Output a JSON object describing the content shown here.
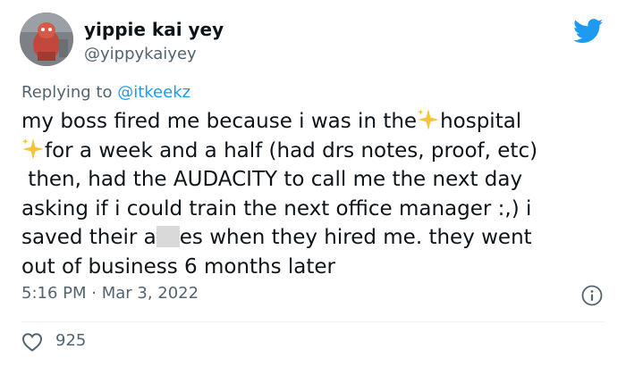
{
  "author": {
    "display_name": "yippie kai yey",
    "handle": "@yippykaiyey",
    "avatar_icon": "avatar-photo"
  },
  "reply": {
    "prefix": "Replying to ",
    "mention": "@itkeekz"
  },
  "tweet": {
    "line1_a": "my boss fired me because i was in the",
    "line1_b": "hospital",
    "line2_b": "for a week and a half (had drs notes, proof, etc)",
    "line3": " then, had the AUDACITY to call me the next day",
    "line4": "asking if i could train the next office manager :,) i",
    "line5_a": "saved their a",
    "line5_b": "es when they hired me. they went",
    "line6": "out of business 6 months later",
    "emoji": "sparkles-emoji"
  },
  "meta": {
    "time": "5:16 PM",
    "separator": " · ",
    "date": "Mar 3, 2022"
  },
  "likes": {
    "count": "925"
  },
  "colors": {
    "brand": "#1d9bf0",
    "text": "#0f1419",
    "muted": "#536471",
    "censor": "#d9d9d9"
  }
}
